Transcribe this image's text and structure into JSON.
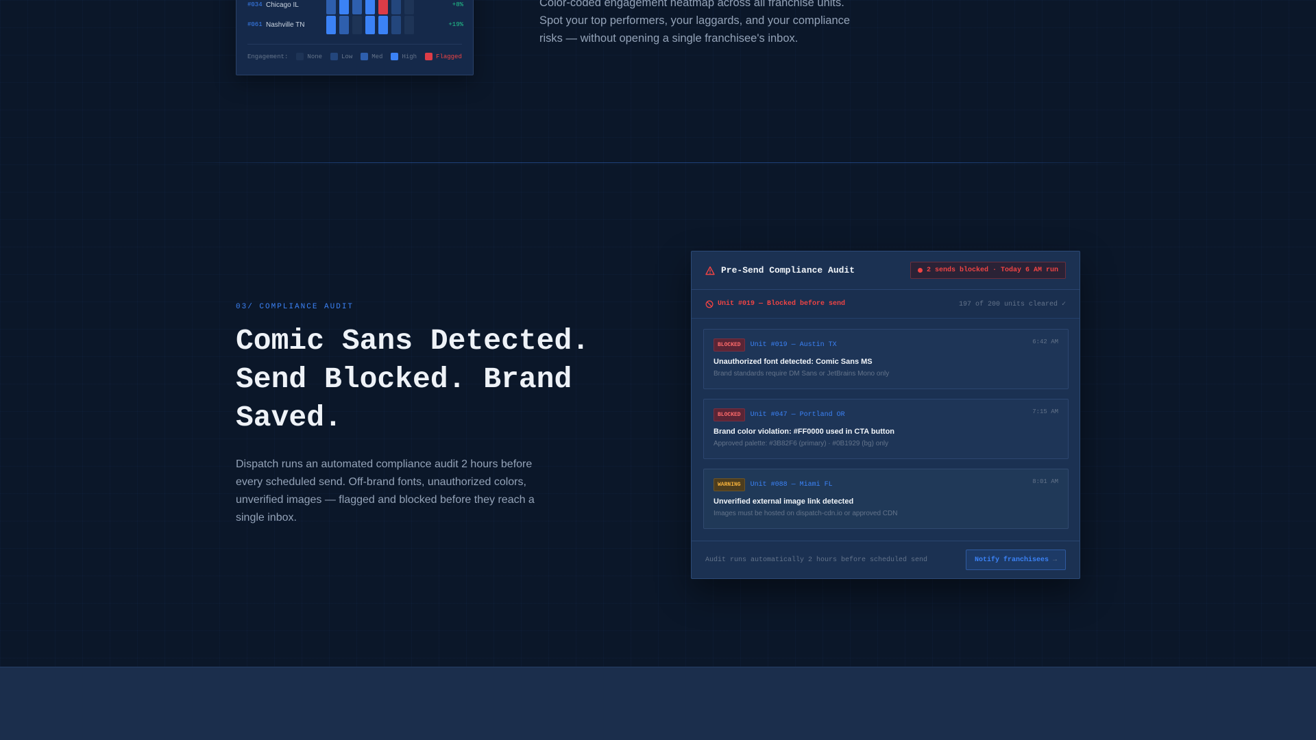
{
  "heatmap": {
    "rows": [
      {
        "id": "#034",
        "name": "Chicago IL",
        "delta": "+8%",
        "levels": [
          "med",
          "high",
          "med",
          "high",
          "flag",
          "low",
          "none"
        ]
      },
      {
        "id": "#061",
        "name": "Nashville TN",
        "delta": "+19%",
        "levels": [
          "high",
          "med",
          "none",
          "high",
          "high",
          "low",
          "none"
        ]
      }
    ],
    "legend": {
      "label": "Engagement:",
      "items": [
        {
          "label": "None",
          "color": "#1e3456"
        },
        {
          "label": "Low",
          "color": "#23467c"
        },
        {
          "label": "Med",
          "color": "#2e5fae"
        },
        {
          "label": "High",
          "color": "#3b82f6"
        },
        {
          "label": "Flagged",
          "color": "#dc3c47"
        }
      ]
    }
  },
  "top_copy": "Color-coded engagement heatmap across all franchise units. Spot your top performers, your laggards, and your compliance risks — without opening a single franchisee's inbox.",
  "section": {
    "eyebrow": "03/ COMPLIANCE AUDIT",
    "headline": "Comic Sans Detected. Send Blocked. Brand Saved.",
    "body": "Dispatch runs an automated compliance audit 2 hours before every scheduled send. Off-brand fonts, unauthorized colors, unverified images — flagged and blocked before they reach a single inbox."
  },
  "audit": {
    "title": "Pre-Send Compliance Audit",
    "pill": "2 sends blocked · Today 6 AM run",
    "status": "Unit #019 — Blocked before send",
    "cleared": "197 of 200 units cleared ✓",
    "issues": [
      {
        "badge": "BLOCKED",
        "unit": "Unit #019 — Austin TX",
        "time": "6:42 AM",
        "title": "Unauthorized font detected: Comic Sans MS",
        "detail": "Brand standards require DM Sans or JetBrains Mono only"
      },
      {
        "badge": "BLOCKED",
        "unit": "Unit #047 — Portland OR",
        "time": "7:15 AM",
        "title": "Brand color violation: #FF0000 used in CTA button",
        "detail": "Approved palette: #3B82F6 (primary) · #0B1929 (bg) only"
      },
      {
        "badge": "WARNING",
        "unit": "Unit #088 — Miami FL",
        "time": "8:01 AM",
        "title": "Unverified external image link detected",
        "detail": "Images must be hosted on dispatch-cdn.io or approved CDN"
      }
    ],
    "footer_note": "Audit runs automatically 2 hours before scheduled send",
    "notify_label": "Notify franchisees",
    "notify_arrow": "→"
  },
  "colors": {
    "accent": "#3b82f6",
    "danger": "#ef4444",
    "warning": "#f5b13b",
    "success": "#22c58b",
    "background": "#0b1729"
  }
}
